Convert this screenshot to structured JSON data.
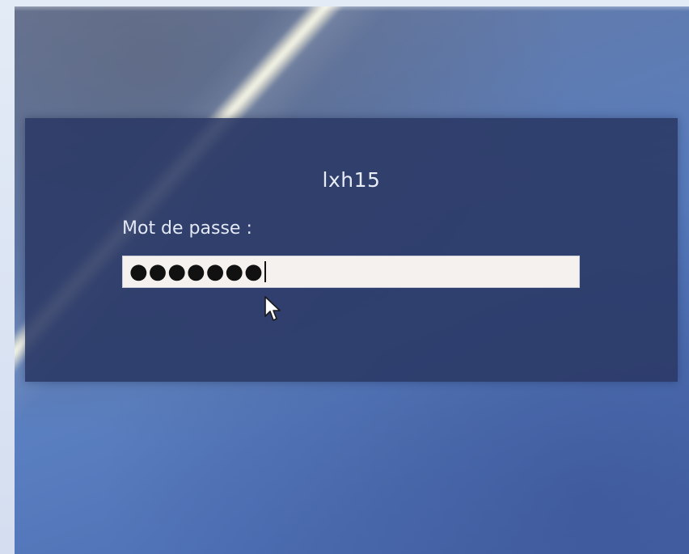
{
  "login": {
    "username": "lxh15",
    "password_label": "Mot de passe :",
    "password_masked": "●●●●●●●"
  },
  "icons": {
    "pointer": "mouse-pointer-icon"
  },
  "colors": {
    "panel": "#2a3864",
    "background": "#5a7fc0",
    "field": "#f4f1ee",
    "text": "#e8ecf7"
  }
}
